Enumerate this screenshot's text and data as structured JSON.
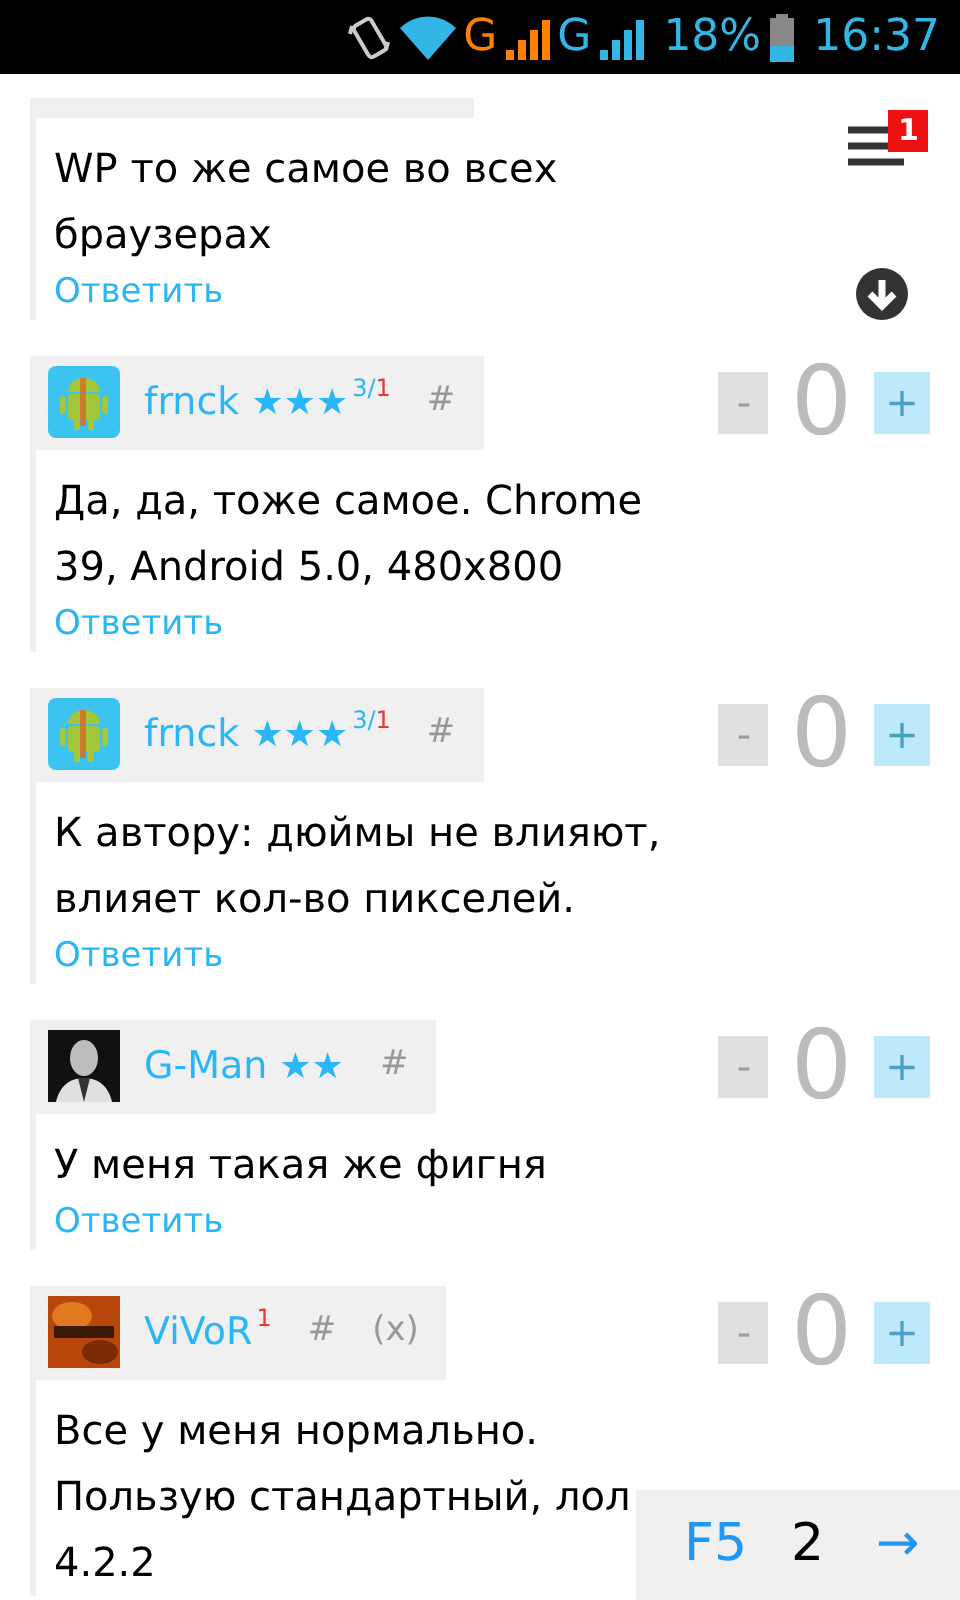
{
  "status_bar": {
    "network_1": "G",
    "network_2": "G",
    "battery": "18%",
    "time": "16:37"
  },
  "menu_badge": "1",
  "comments": [
    {
      "lines": [
        "WP то же самое во всех",
        "браузерах"
      ],
      "reply": "Ответить"
    },
    {
      "avatar": {
        "kind": "android"
      },
      "user": "frnck",
      "rank": "★★★",
      "sup": [
        {
          "text": "3/",
          "color": "#29b6f6"
        },
        {
          "text": "1",
          "color": "#e53935"
        }
      ],
      "links": [
        "#"
      ],
      "minus": "-",
      "score": "0",
      "plus": "+",
      "lines": [
        "Да, да, тоже самое. Chrome",
        "39, Android 5.0, 480x800"
      ],
      "reply": "Ответить"
    },
    {
      "avatar": {
        "kind": "android"
      },
      "user": "frnck",
      "rank": "★★★",
      "sup": [
        {
          "text": "3/",
          "color": "#29b6f6"
        },
        {
          "text": "1",
          "color": "#e53935"
        }
      ],
      "links": [
        "#"
      ],
      "minus": "-",
      "score": "0",
      "plus": "+",
      "lines": [
        "К автору: дюймы не влияют,",
        "влияет кол-во пикселей."
      ],
      "reply": "Ответить"
    },
    {
      "avatar": {
        "kind": "person"
      },
      "user": "G-Man",
      "rank": "★★",
      "links": [
        "#"
      ],
      "minus": "-",
      "score": "0",
      "plus": "+",
      "lines": [
        "У меня такая же фигня"
      ],
      "reply": "Ответить"
    },
    {
      "avatar": {
        "kind": "flame"
      },
      "user": "ViVoR",
      "sup": [
        {
          "text": "1",
          "color": "#e53935"
        }
      ],
      "links": [
        "#",
        "(x)"
      ],
      "minus": "-",
      "score": "0",
      "plus": "+",
      "lines": [
        "Все у меня нормально.",
        "Пользую стандартный, лол",
        "4.2.2"
      ]
    }
  ],
  "pager": {
    "refresh": "F5",
    "page": "2",
    "next": "→"
  }
}
